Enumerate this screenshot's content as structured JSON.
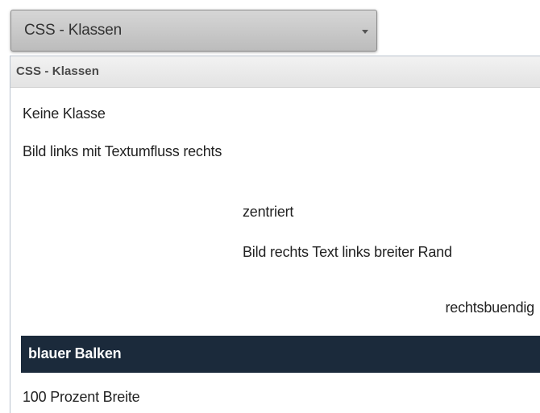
{
  "combo": {
    "label": "CSS - Klassen",
    "arrow_icon": "caret-down-icon"
  },
  "dropdown": {
    "header": "CSS - Klassen",
    "options": [
      {
        "label": "Keine Klasse"
      },
      {
        "label": "Bild links mit Textumfluss rechts"
      },
      {
        "label": "zentriert"
      },
      {
        "label": "Bild rechts Text links breiter Rand"
      },
      {
        "label": "rechtsbuendig"
      },
      {
        "label": "blauer Balken",
        "highlighted": true
      },
      {
        "label": "100 Prozent Breite"
      }
    ]
  },
  "colors": {
    "highlight_bg": "#1b2a3b",
    "highlight_text": "#ffffff",
    "text": "#222222"
  }
}
